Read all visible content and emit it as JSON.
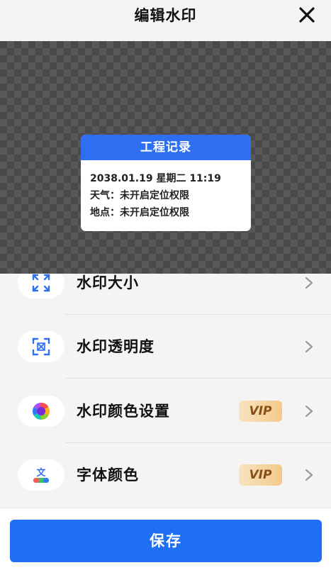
{
  "header": {
    "title": "编辑水印",
    "close_icon": "close-icon"
  },
  "watermark": {
    "title": "工程记录",
    "datetime": "2038.01.19 星期二 11:19",
    "weather": "天气：未开启定位权限",
    "location": "地点：未开启定位权限"
  },
  "options": [
    {
      "label": "水印大小",
      "icon": "resize-icon",
      "vip": ""
    },
    {
      "label": "水印透明度",
      "icon": "opacity-icon",
      "vip": ""
    },
    {
      "label": "水印颜色设置",
      "icon": "color-wheel-icon",
      "vip": "VIP"
    },
    {
      "label": "字体颜色",
      "icon": "font-color-icon",
      "vip": "VIP"
    }
  ],
  "footer": {
    "save_label": "保存"
  },
  "colors": {
    "accent": "#1f6ff5",
    "watermark_header": "#2e6ff2",
    "vip_text": "#8a4f16",
    "vip_bg": "#f3c98a"
  }
}
